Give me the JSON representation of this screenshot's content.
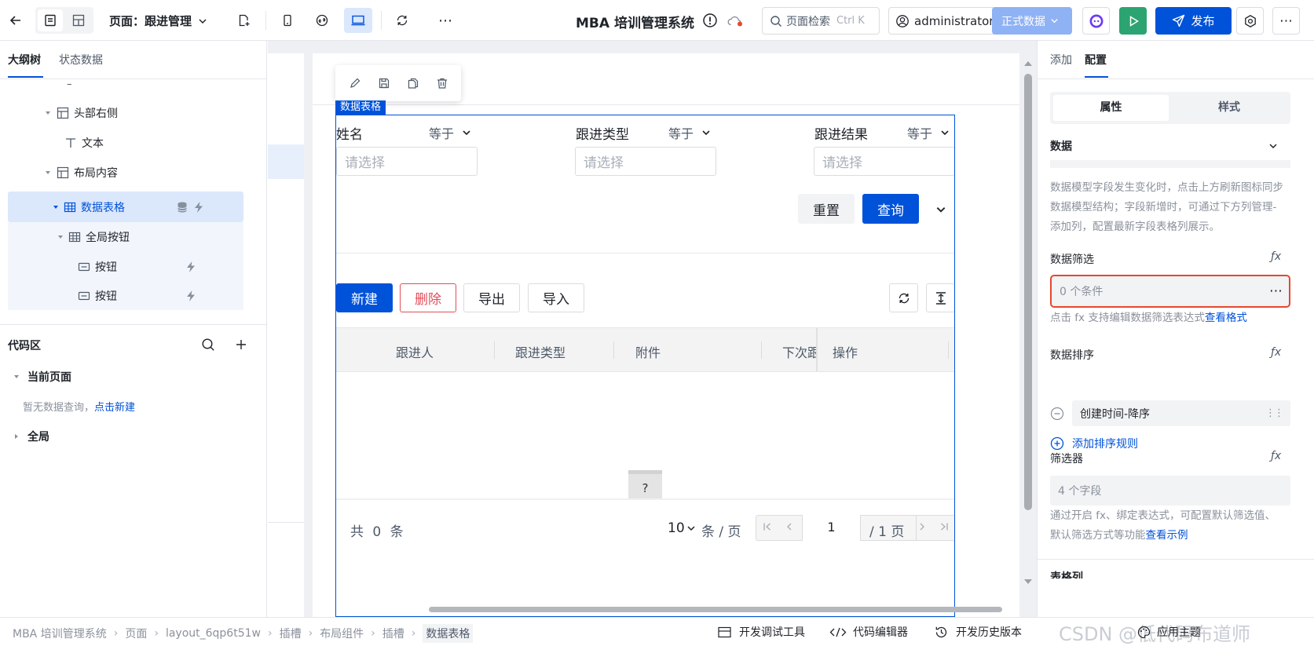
{
  "topbar": {
    "page_label": "页面：跟进管理",
    "app_title": "MBA 培训管理系统",
    "search_placeholder": "页面检索",
    "search_shortcut": "Ctrl K",
    "user": "administrator",
    "env": "正式数据",
    "publish": "发布"
  },
  "left": {
    "tabs": [
      "大纲树",
      "状态数据"
    ],
    "dash": "–",
    "tree": [
      {
        "label": "头部右侧",
        "icon": "layout-icon"
      },
      {
        "label": "文本",
        "icon": "text-icon"
      },
      {
        "label": "布局内容",
        "icon": "layout-icon"
      },
      {
        "label": "数据表格",
        "icon": "table-icon"
      },
      {
        "label": "全局按钮",
        "icon": "table-icon"
      },
      {
        "label": "按钮",
        "icon": "button-icon"
      },
      {
        "label": "按钮",
        "icon": "button-icon"
      }
    ],
    "code_title": "代码区",
    "current_page": "当前页面",
    "empty_text": "暂无数据查询，",
    "create_link": "点击新建",
    "global": "全局"
  },
  "canvas": {
    "selected_tag": "数据表格",
    "filters": [
      {
        "label": "姓名",
        "op": "等于",
        "placeholder": "请选择"
      },
      {
        "label": "跟进类型",
        "op": "等于",
        "placeholder": "请选择"
      },
      {
        "label": "跟进结果",
        "op": "等于",
        "placeholder": "请选择"
      }
    ],
    "reset": "重置",
    "query": "查询",
    "actions": [
      "新建",
      "删除",
      "导出",
      "导入"
    ],
    "columns": [
      "跟进人",
      "跟进类型",
      "附件",
      "下次跟",
      "操作"
    ],
    "empty_mark": "?",
    "total_prefix": "共",
    "total": "0",
    "total_suffix": "条",
    "page_size": "10",
    "page_size_unit": "条 / 页",
    "current_page": "1",
    "page_total": "/ 1 页"
  },
  "right": {
    "tabs": [
      "添加",
      "配置"
    ],
    "seg": [
      "属性",
      "样式"
    ],
    "data_title": "数据",
    "data_hint": "数据模型字段发生变化时，点击上方刷新图标同步数据模型结构；字段新增时，可通过下方列管理-添加列，配置最新字段表格列展示。",
    "filter_title": "数据筛选",
    "filter_value": "0 个条件",
    "filter_hint": "点击 fx 支持编辑数据筛选表达式",
    "filter_link": "查看格式",
    "sort_title": "数据排序",
    "sort_item": "创建时间-降序",
    "sort_add": "添加排序规则",
    "selector_title": "筛选器",
    "selector_value": "4 个字段",
    "selector_hint": "通过开启 fx、绑定表达式，可配置默认筛选值、默认筛选方式等功能",
    "selector_link": "查看示例",
    "cut_title": "表格列"
  },
  "bottom": {
    "breadcrumb": [
      "MBA 培训管理系统",
      "页面",
      "layout_6qp6t51w",
      "插槽",
      "布局组件",
      "插槽",
      "数据表格"
    ],
    "tools": [
      "开发调试工具",
      "代码编辑器",
      "开发历史版本"
    ],
    "theme": "应用主题",
    "watermark": "CSDN @低代码布道师"
  },
  "colors": {
    "primary": "#0052d9",
    "danger": "#e34d59",
    "highlight": "#e5482f",
    "success": "#2ba471"
  }
}
